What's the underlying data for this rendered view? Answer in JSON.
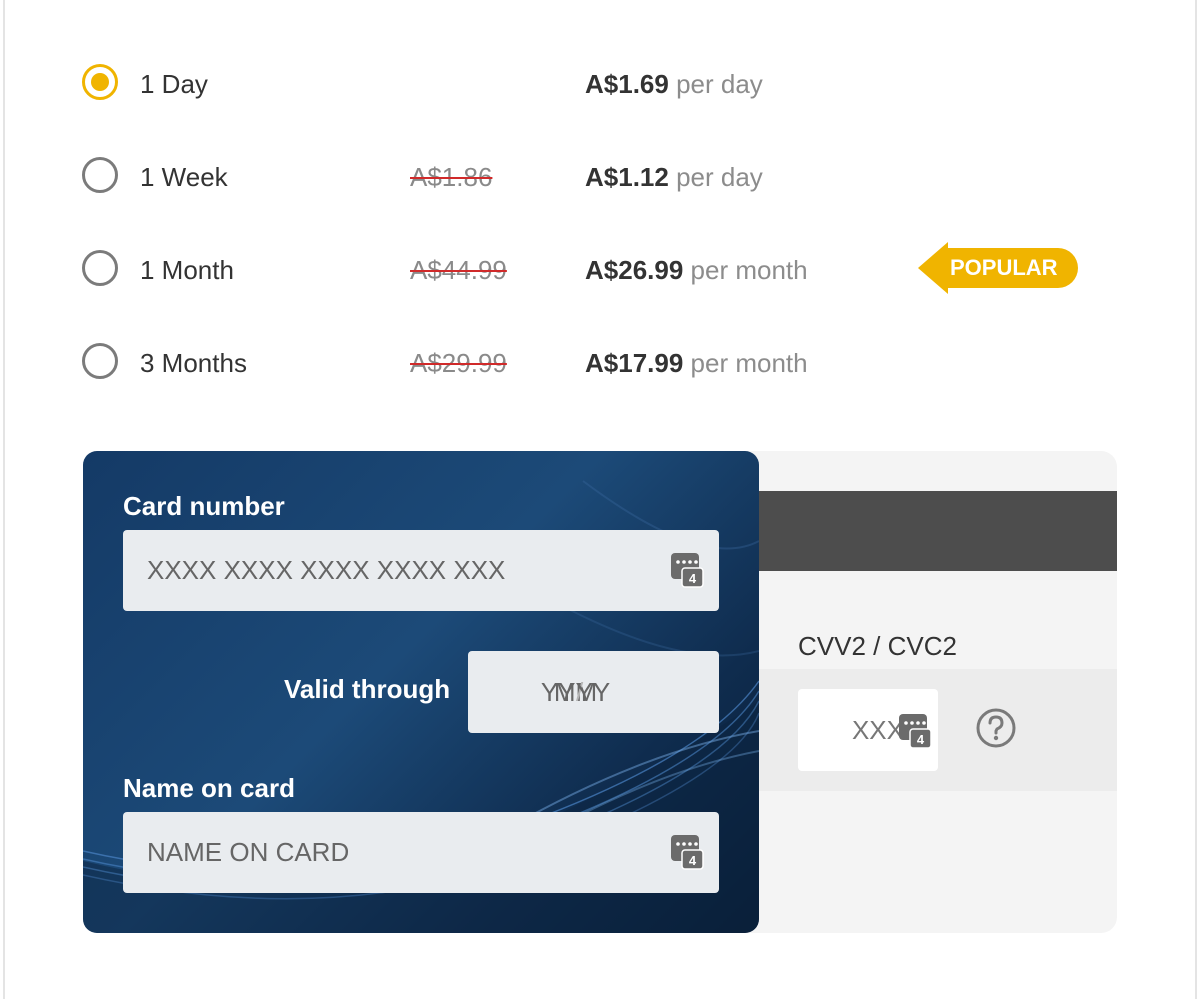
{
  "plans": [
    {
      "name": "1 Day",
      "old_price": "",
      "price": "A$1.69",
      "unit": "per day",
      "selected": true,
      "badge": ""
    },
    {
      "name": "1 Week",
      "old_price": "A$1.86",
      "price": "A$1.12",
      "unit": "per day",
      "selected": false,
      "badge": ""
    },
    {
      "name": "1 Month",
      "old_price": "A$44.99",
      "price": "A$26.99",
      "unit": "per month",
      "selected": false,
      "badge": "POPULAR"
    },
    {
      "name": "3 Months",
      "old_price": "A$29.99",
      "price": "A$17.99",
      "unit": "per month",
      "selected": false,
      "badge": ""
    }
  ],
  "card_form": {
    "card_number_label": "Card number",
    "card_number_placeholder": "XXXX XXXX XXXX XXXX XXX",
    "valid_through_label": "Valid through",
    "month_placeholder": "MM",
    "year_placeholder": "YYYY",
    "separator": "/",
    "name_label": "Name on card",
    "name_placeholder": "NAME ON CARD",
    "cvv_label": "CVV2 / CVC2",
    "cvv_placeholder": "XXX"
  },
  "keyboard_icon_digit": "4",
  "colors": {
    "accent": "#f0b400",
    "strike": "#d02a2a",
    "card_front": "#1c4a78",
    "mag_stripe": "#4d4d4d"
  }
}
